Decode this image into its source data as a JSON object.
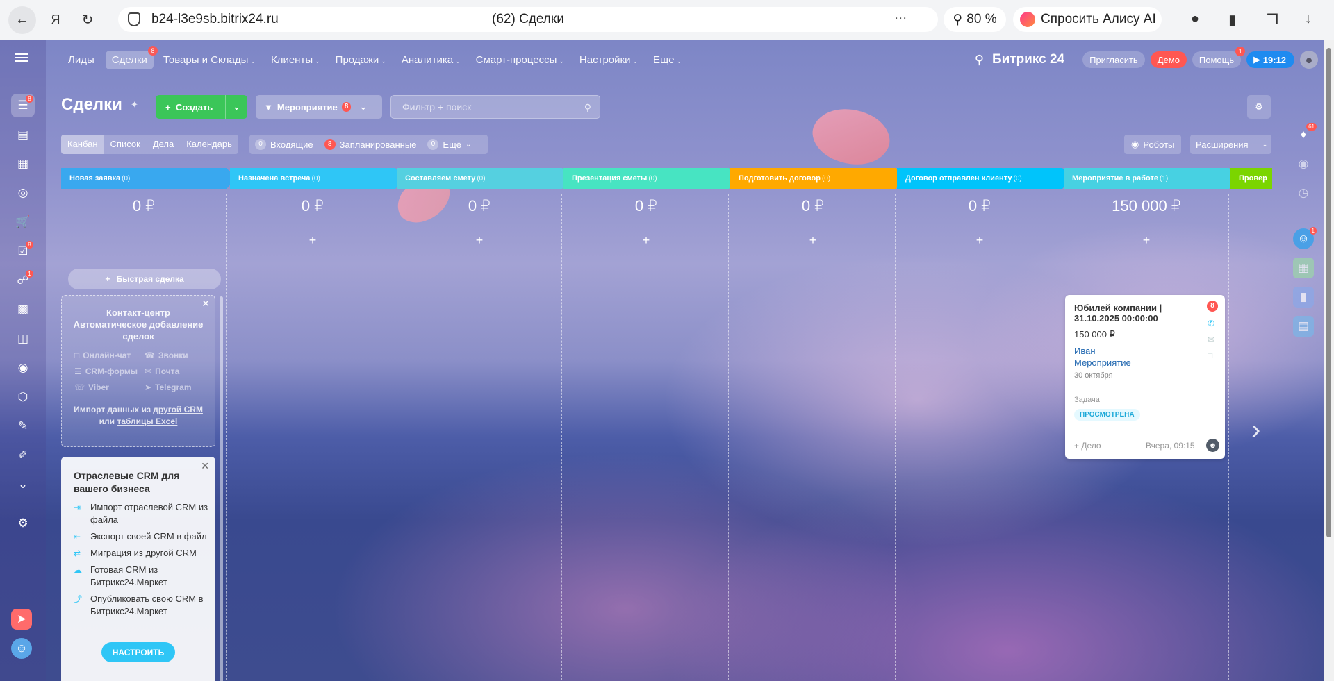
{
  "browser": {
    "address": "b24-l3e9sb.bitrix24.ru",
    "tab_title": "(62) Сделки",
    "zoom": "80 %",
    "alice": "Спросить Алису AI"
  },
  "nav": {
    "items": [
      {
        "label": "Лиды",
        "caret": false
      },
      {
        "label": "Сделки",
        "caret": false,
        "active": true,
        "badge": "8"
      },
      {
        "label": "Товары и Склады",
        "caret": true
      },
      {
        "label": "Клиенты",
        "caret": true
      },
      {
        "label": "Продажи",
        "caret": true
      },
      {
        "label": "Аналитика",
        "caret": true
      },
      {
        "label": "Смарт-процессы",
        "caret": true
      },
      {
        "label": "Настройки",
        "caret": true
      },
      {
        "label": "Еще",
        "caret": true
      }
    ],
    "logo": "Битрикс 24",
    "invite": "Пригласить",
    "demo": "Демо",
    "help": "Помощь",
    "help_badge": "1",
    "time": "19:12"
  },
  "left_menu": {
    "badges": {
      "crm": "8",
      "tasks": "8",
      "bp": "1"
    }
  },
  "toolbar": {
    "title": "Сделки",
    "create": "Создать",
    "category": "Мероприятие",
    "category_badge": "8",
    "search_placeholder": "Фильтр + поиск"
  },
  "views": [
    "Канбан",
    "Список",
    "Дела",
    "Календарь"
  ],
  "counters": [
    {
      "n": "0",
      "label": "Входящие",
      "red": false
    },
    {
      "n": "8",
      "label": "Запланированные",
      "red": true
    },
    {
      "n": "0",
      "label": "Ещё",
      "red": false
    }
  ],
  "robots": "Роботы",
  "extensions": "Расширения",
  "columns": [
    {
      "title": "Новая заявка",
      "count": "(0)",
      "sum": "0 ₽",
      "color": "#39a8ef"
    },
    {
      "title": "Назначена встреча",
      "count": "(0)",
      "sum": "0 ₽",
      "color": "#2fc6f6"
    },
    {
      "title": "Составляем смету",
      "count": "(0)",
      "sum": "0 ₽",
      "color": "#55d0e0"
    },
    {
      "title": "Презентация сметы",
      "count": "(0)",
      "sum": "0 ₽",
      "color": "#47e4c2"
    },
    {
      "title": "Подготовить договор",
      "count": "(0)",
      "sum": "0 ₽",
      "color": "#ffa900"
    },
    {
      "title": "Договор отправлен клиенту",
      "count": "(0)",
      "sum": "0 ₽",
      "color": "#00c4fb"
    },
    {
      "title": "Мероприятие в работе",
      "count": "(1)",
      "sum": "150 000 ₽",
      "color": "#47d1e2"
    },
    {
      "title": "Провер",
      "count": "",
      "sum": "",
      "color": "#7bd500"
    }
  ],
  "quick_deal": "Быстрая сделка",
  "contact_center": {
    "title": "Контакт-центр Автоматическое добавление сделок",
    "channels": [
      "Онлайн-чат",
      "Звонки",
      "CRM-формы",
      "Почта",
      "Viber",
      "Telegram"
    ],
    "import_prefix": "Импорт данных из",
    "import_link1": "другой CRM",
    "import_mid": "или",
    "import_link2": "таблицы Excel"
  },
  "industry": {
    "title": "Отраслевые CRM для вашего бизнеса",
    "items": [
      "Импорт отраслевой CRM из файла",
      "Экспорт своей CRM в файл",
      "Миграция из другой CRM",
      "Готовая CRM из Битрикс24.Маркет",
      "Опубликовать свою CRM в Битрикс24.Маркет"
    ],
    "button": "НАСТРОИТЬ"
  },
  "deal": {
    "title": "Юбилей компании | 31.10.2025 00:00:00",
    "sum": "150 000 ₽",
    "contact": "Иван",
    "company": "Мероприятие",
    "date": "30 октября",
    "task_label": "Задача",
    "tag": "ПРОСМОТРЕНА",
    "add_activity": "+ Дело",
    "when": "Вчера, 09:15",
    "badge": "8"
  },
  "right_panel": {
    "notif_badge": "61",
    "chat_badge": "1"
  }
}
